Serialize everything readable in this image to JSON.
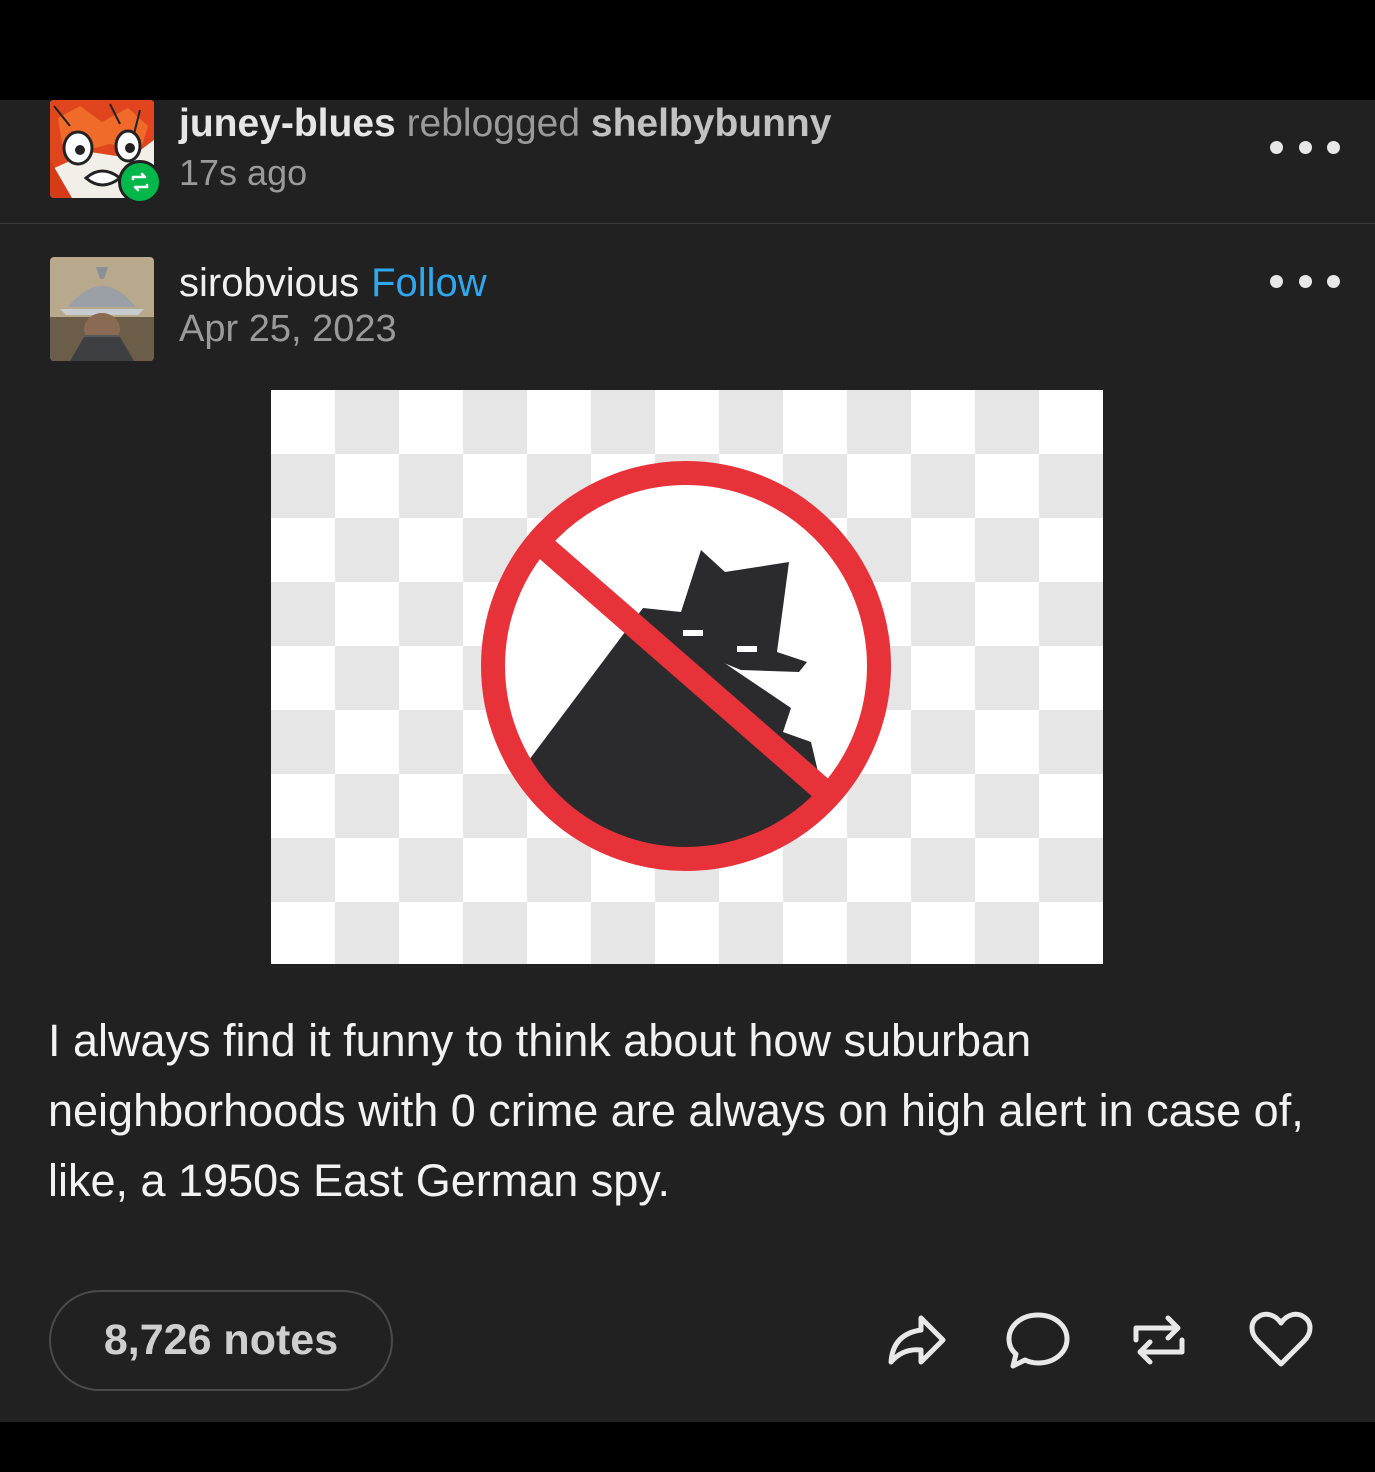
{
  "reblog": {
    "user": "juney-blues",
    "verb": "reblogged",
    "source": "shelbybunny",
    "time": "17s ago"
  },
  "post": {
    "author": "sirobvious",
    "follow_label": "Follow",
    "date": "Apr 25, 2023",
    "body": "I always find it funny to think about how suburban neighborhoods with 0 crime are always on high alert in case of, like, a 1950s East German spy.",
    "notes_label": "8,726 notes"
  },
  "icons": {
    "share": "share-icon",
    "reply": "reply-icon",
    "reblog": "reblog-icon",
    "like": "heart-icon",
    "more": "more-icon"
  },
  "colors": {
    "background": "#212121",
    "follow": "#2fa8f0",
    "reblog_badge": "#00b84a",
    "prohibition_red": "#e8323a"
  }
}
